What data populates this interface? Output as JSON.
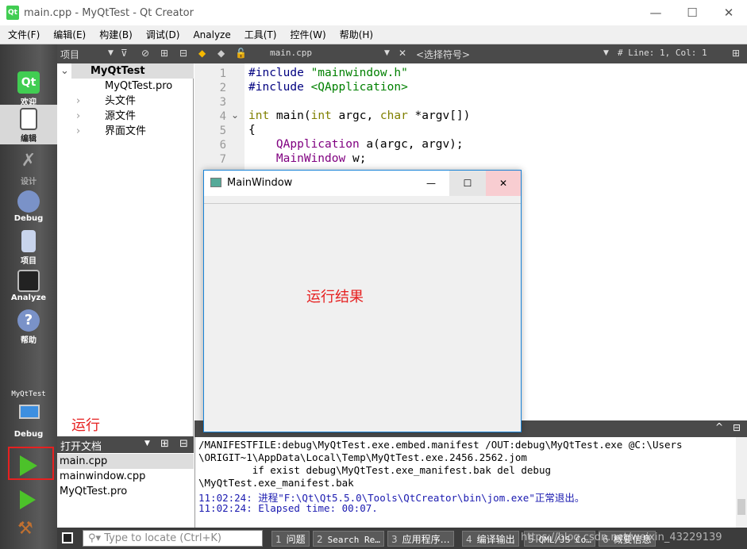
{
  "window": {
    "title": "main.cpp - MyQtTest - Qt Creator",
    "minimize": "—",
    "maximize": "☐",
    "close": "✕"
  },
  "menu": [
    "文件(F)",
    "编辑(E)",
    "构建(B)",
    "调试(D)",
    "Analyze",
    "工具(T)",
    "控件(W)",
    "帮助(H)"
  ],
  "toolbar": {
    "project_label": "项目",
    "file": "main.cpp",
    "symbol": "<选择符号>",
    "position": "#  Line: 1, Col: 1"
  },
  "modes": [
    {
      "label": "欢迎",
      "icon": "qt-logo-icon"
    },
    {
      "label": "编辑",
      "icon": "edit-document-icon",
      "active": true
    },
    {
      "label": "设计",
      "icon": "design-tools-icon"
    },
    {
      "label": "Debug",
      "icon": "bug-icon"
    },
    {
      "label": "项目",
      "icon": "folder-icon"
    },
    {
      "label": "Analyze",
      "icon": "oscilloscope-icon"
    },
    {
      "label": "帮助",
      "icon": "help-icon"
    }
  ],
  "kit": {
    "project": "MyQtTest",
    "config": "Debug"
  },
  "tree": {
    "root": "MyQtTest",
    "items": [
      "MyQtTest.pro",
      "头文件",
      "源文件",
      "界面文件"
    ]
  },
  "editor": {
    "line_numbers": [
      "1",
      "2",
      "3",
      "4",
      "5",
      "6",
      "7"
    ]
  },
  "output": {
    "lines": [
      "/MANIFESTFILE:debug\\MyQtTest.exe.embed.manifest /OUT:debug\\MyQtTest.exe @C:\\Users",
      "\\ORIGIT~1\\AppData\\Local\\Temp\\MyQtTest.exe.2456.2562.jom",
      "         if exist debug\\MyQtTest.exe_manifest.bak del debug",
      "\\MyQtTest.exe_manifest.bak",
      "11:02:24: 进程\"F:\\Qt\\Qt5.5.0\\Tools\\QtCreator\\bin\\jom.exe\"正常退出。",
      "11:02:24: Elapsed time: 00:07."
    ]
  },
  "open_docs": {
    "title": "打开文档",
    "items": [
      "main.cpp",
      "mainwindow.cpp",
      "MyQtTest.pro"
    ]
  },
  "status": {
    "locate_placeholder": "Type to locate (Ctrl+K)",
    "tabs": [
      {
        "n": "1",
        "label": "问题"
      },
      {
        "n": "2",
        "label": "Search Re…"
      },
      {
        "n": "3",
        "label": "应用程序…"
      },
      {
        "n": "4",
        "label": "编译输出"
      },
      {
        "n": "5",
        "label": "QML/JS Co…"
      },
      {
        "n": "6",
        "label": "概要信息"
      }
    ],
    "watermark": "https://blog.csdn.net/weixin_43229139"
  },
  "app_window": {
    "title": "MainWindow",
    "minimize": "—",
    "maximize": "☐",
    "close": "✕"
  },
  "annotations": {
    "run": "运行",
    "result": "运行结果"
  },
  "colors": {
    "annotation": "#e62020",
    "accent": "#1883d7"
  }
}
